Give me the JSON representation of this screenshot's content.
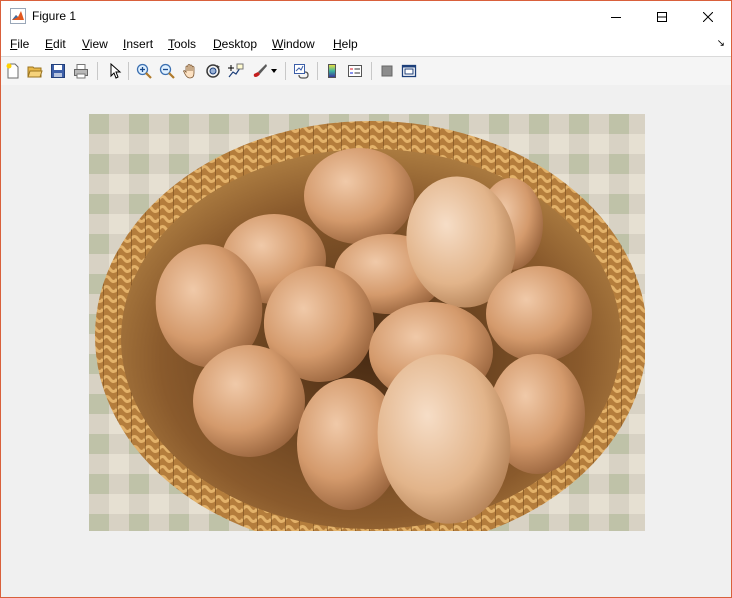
{
  "window": {
    "title": "Figure 1",
    "icon": "matlab-icon",
    "controls": [
      "minimize-icon",
      "maximize-icon",
      "close-icon"
    ]
  },
  "menu": {
    "items": [
      {
        "text": "File",
        "u": "F",
        "rest": "ile"
      },
      {
        "text": "Edit",
        "u": "E",
        "rest": "dit"
      },
      {
        "text": "View",
        "u": "V",
        "rest": "iew"
      },
      {
        "text": "Insert",
        "u": "I",
        "rest": "nsert"
      },
      {
        "text": "Tools",
        "u": "T",
        "rest": "ools"
      },
      {
        "text": "Desktop",
        "u": "D",
        "rest": "esktop"
      },
      {
        "text": "Window",
        "u": "W",
        "rest": "indow"
      },
      {
        "text": "Help",
        "u": "H",
        "rest": "elp"
      }
    ],
    "dock_arrow": "↘"
  },
  "toolbar": {
    "buttons": [
      "new-figure-icon",
      "open-file-icon",
      "save-icon",
      "print-icon",
      "edit-plot-icon",
      "zoom-in-icon",
      "zoom-out-icon",
      "pan-icon",
      "rotate-3d-icon",
      "data-cursor-icon",
      "brush-icon",
      "link-plot-icon",
      "insert-colorbar-icon",
      "insert-legend-icon",
      "hide-plot-tools-icon",
      "show-plot-tools-icon"
    ]
  },
  "figure": {
    "content": "image-of-brown-eggs-in-wicker-basket"
  },
  "colors": {
    "window_border": "#d9603b",
    "figure_background": "#f0f0f0"
  }
}
